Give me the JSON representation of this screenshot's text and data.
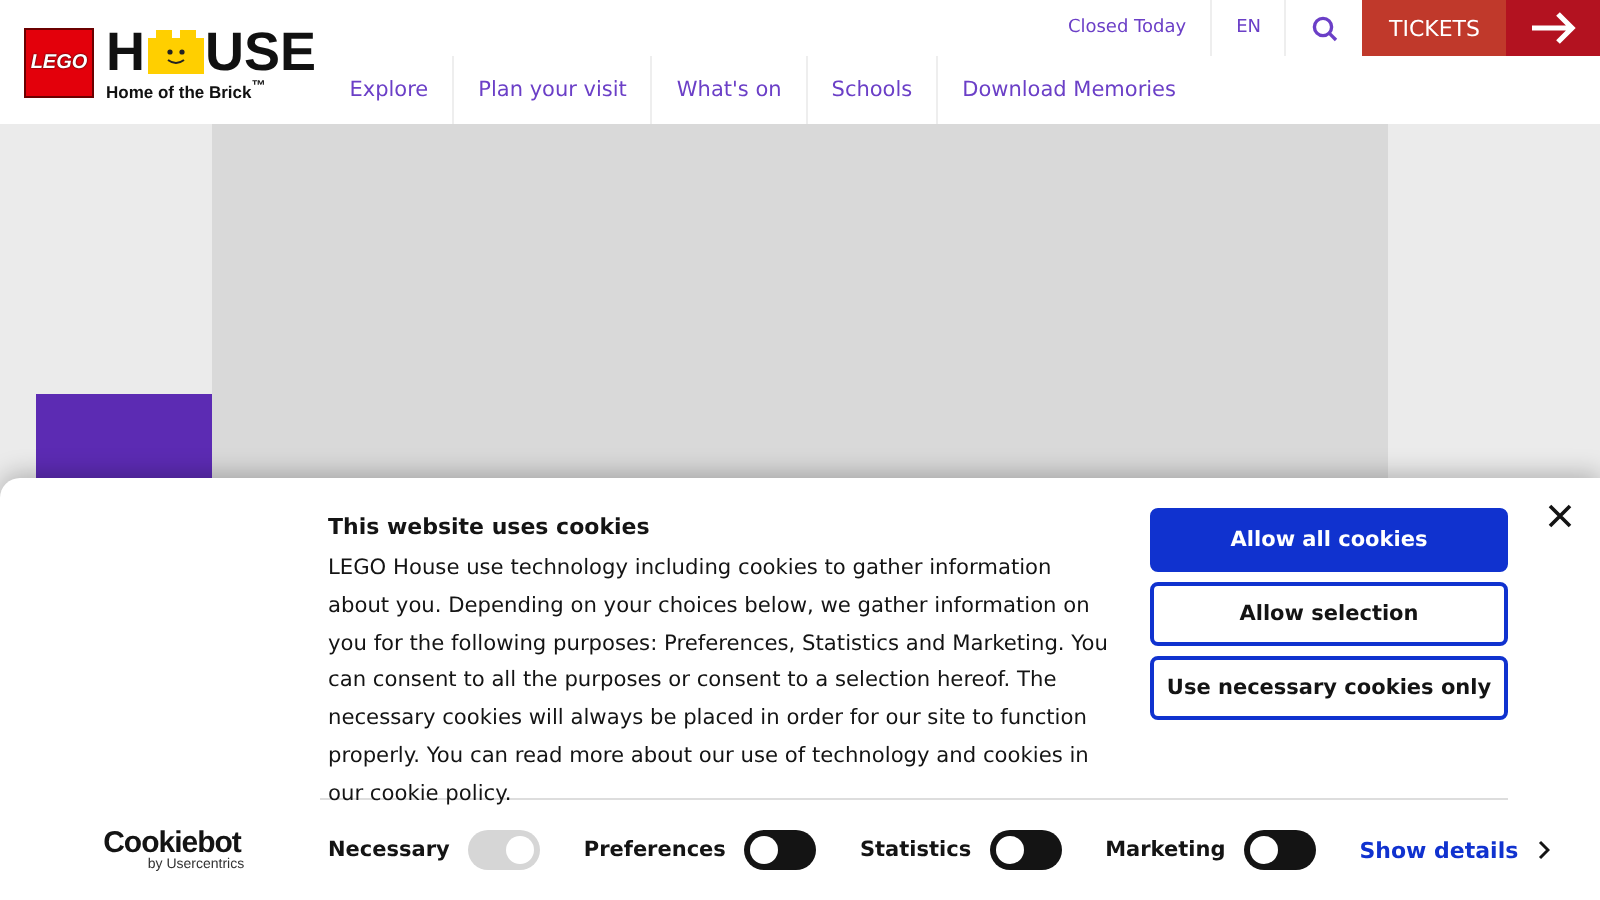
{
  "header": {
    "logo": {
      "badge": "LEGO",
      "wordmark_start": "H",
      "wordmark_end": "USE",
      "tagline": "Home of the Brick$^{™}$"
    },
    "utility": [
      {
        "kind": "text",
        "label": "Closed Today"
      },
      {
        "kind": "text",
        "label": "EN"
      },
      {
        "kind": "search"
      }
    ],
    "tickets": {
      "label": "TICKETS"
    },
    "nav": [
      {
        "label": "Explore"
      },
      {
        "label": "Plan your visit"
      },
      {
        "label": "What's on"
      },
      {
        "label": "Schools"
      },
      {
        "label": "Download Memories"
      }
    ]
  },
  "cookie_banner": {
    "title": "This website uses cookies",
    "body": "LEGO House use technology including cookies to gather information about you. Depending on your choices below, we gather information on you for the following purposes: Preferences, Statistics and Marketing. You can consent to all the purposes or consent to a selection hereof. The necessary cookies will always be placed in order for our site to function properly. You can read more about our use of technology and cookies in our cookie policy.",
    "buttons": [
      {
        "label": "Allow all cookies",
        "primary": true
      },
      {
        "label": "Allow selection",
        "primary": false
      },
      {
        "label": "Use necessary cookies only",
        "primary": false
      }
    ],
    "brand": {
      "name": "Cookiebot",
      "byline": "by Usercentrics"
    },
    "toggles": [
      {
        "label": "Necessary",
        "on": true,
        "disabled": true
      },
      {
        "label": "Preferences",
        "on": false,
        "disabled": false
      },
      {
        "label": "Statistics",
        "on": false,
        "disabled": false
      },
      {
        "label": "Marketing",
        "on": false,
        "disabled": false
      }
    ],
    "details_link": "Show details"
  }
}
